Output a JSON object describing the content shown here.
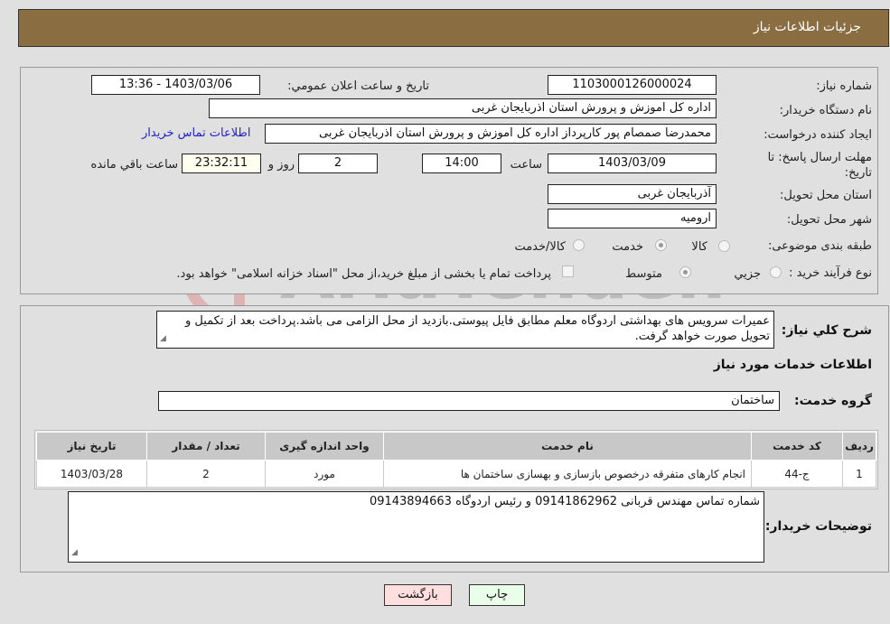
{
  "header": {
    "title": "جزئیات اطلاعات نیاز"
  },
  "details": {
    "need_number_label": "شماره نیاز:",
    "need_number": "1103000126000024",
    "announce_label": "تاريخ و ساعت اعلان عمومي:",
    "announce_value": "1403/03/06 - 13:36",
    "buyer_org_label": "نام دستگاه خريدار:",
    "buyer_org": "اداره کل اموزش و پرورش استان اذربایجان غربی",
    "creator_label": "ايجاد کننده درخواست:",
    "creator": "محمدرضا صمصام پور کارپرداز اداره کل اموزش و پرورش استان اذربایجان غربی",
    "contact_link": "اطلاعات تماس خريدار",
    "deadline_label_line1": "مهلت ارسال پاسخ: تا",
    "deadline_label_line2": "تاريخ:",
    "deadline_date": "1403/03/09",
    "time_label": "ساعت",
    "deadline_time": "14:00",
    "days_value": "2",
    "days_label": "روز و",
    "remaining_time": "23:32:11",
    "remaining_label": "ساعت باقي مانده",
    "province_label": "استان محل تحويل:",
    "province": "آذربایجان غربی",
    "city_label": "شهر محل تحويل:",
    "city": "ارومیه",
    "category_label": "طبقه بندی موضوعی:",
    "category_options": [
      {
        "label": "کالا",
        "checked": false
      },
      {
        "label": "خدمت",
        "checked": true
      },
      {
        "label": "کالا/خدمت",
        "checked": false
      }
    ],
    "process_label": "نوع فرآيند خريد :",
    "process_options": [
      {
        "label": "جزيي",
        "checked": false
      },
      {
        "label": "متوسط",
        "checked": true
      }
    ],
    "treasury_note": "پرداخت تمام یا بخشی از مبلغ خرید،از محل \"اسناد خزانه اسلامی\" خواهد بود."
  },
  "description": {
    "label": "شرح کلي نياز:",
    "text": "عمیرات سرویس های بهداشتی اردوگاه معلم مطابق فایل پیوستی.بازدید از محل الزامی می باشد.پرداخت بعد از تکمیل و تحویل صورت خواهد گرفت."
  },
  "services": {
    "section_title": "اطلاعات خدمات مورد نياز",
    "group_label": "گروه خدمت:",
    "group_value": "ساختمان",
    "columns": [
      "رديف",
      "کد خدمت",
      "نام خدمت",
      "واحد اندازه گيری",
      "تعداد / مقدار",
      "تاريخ نياز"
    ],
    "rows": [
      [
        "1",
        "ج-44",
        "انجام کارهای متفرقه درخصوص بازسازی و بهسازی ساختمان ها",
        "مورد",
        "2",
        "1403/03/28"
      ]
    ]
  },
  "buyer_notes": {
    "label": "توضيحات خريدار:",
    "text": "شماره تماس مهندس قربانی 09141862962 و رئیس اردوگاه 09143894663"
  },
  "buttons": {
    "print": "چاپ",
    "back": "بازگشت"
  },
  "watermark": {
    "text": "AriaTender.neT"
  },
  "colors": {
    "header_bg": "#8b6d42",
    "print_bg": "#eaffea",
    "back_bg": "#ffdede",
    "link": "#2222cc"
  }
}
